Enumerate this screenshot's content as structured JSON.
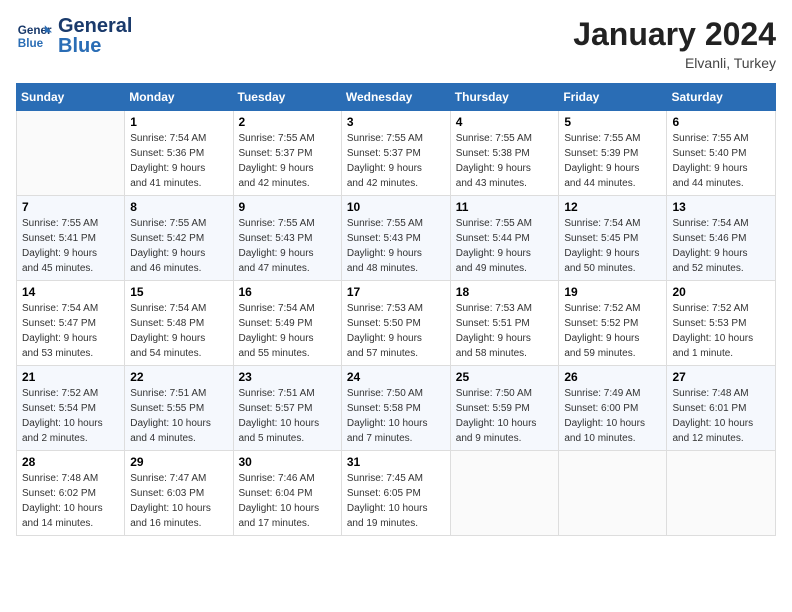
{
  "header": {
    "logo_text_general": "General",
    "logo_text_blue": "Blue",
    "month_title": "January 2024",
    "location": "Elvanli, Turkey"
  },
  "weekdays": [
    "Sunday",
    "Monday",
    "Tuesday",
    "Wednesday",
    "Thursday",
    "Friday",
    "Saturday"
  ],
  "weeks": [
    [
      {
        "day": "",
        "content": ""
      },
      {
        "day": "1",
        "content": "Sunrise: 7:54 AM\nSunset: 5:36 PM\nDaylight: 9 hours\nand 41 minutes."
      },
      {
        "day": "2",
        "content": "Sunrise: 7:55 AM\nSunset: 5:37 PM\nDaylight: 9 hours\nand 42 minutes."
      },
      {
        "day": "3",
        "content": "Sunrise: 7:55 AM\nSunset: 5:37 PM\nDaylight: 9 hours\nand 42 minutes."
      },
      {
        "day": "4",
        "content": "Sunrise: 7:55 AM\nSunset: 5:38 PM\nDaylight: 9 hours\nand 43 minutes."
      },
      {
        "day": "5",
        "content": "Sunrise: 7:55 AM\nSunset: 5:39 PM\nDaylight: 9 hours\nand 44 minutes."
      },
      {
        "day": "6",
        "content": "Sunrise: 7:55 AM\nSunset: 5:40 PM\nDaylight: 9 hours\nand 44 minutes."
      }
    ],
    [
      {
        "day": "7",
        "content": "Sunrise: 7:55 AM\nSunset: 5:41 PM\nDaylight: 9 hours\nand 45 minutes."
      },
      {
        "day": "8",
        "content": "Sunrise: 7:55 AM\nSunset: 5:42 PM\nDaylight: 9 hours\nand 46 minutes."
      },
      {
        "day": "9",
        "content": "Sunrise: 7:55 AM\nSunset: 5:43 PM\nDaylight: 9 hours\nand 47 minutes."
      },
      {
        "day": "10",
        "content": "Sunrise: 7:55 AM\nSunset: 5:43 PM\nDaylight: 9 hours\nand 48 minutes."
      },
      {
        "day": "11",
        "content": "Sunrise: 7:55 AM\nSunset: 5:44 PM\nDaylight: 9 hours\nand 49 minutes."
      },
      {
        "day": "12",
        "content": "Sunrise: 7:54 AM\nSunset: 5:45 PM\nDaylight: 9 hours\nand 50 minutes."
      },
      {
        "day": "13",
        "content": "Sunrise: 7:54 AM\nSunset: 5:46 PM\nDaylight: 9 hours\nand 52 minutes."
      }
    ],
    [
      {
        "day": "14",
        "content": "Sunrise: 7:54 AM\nSunset: 5:47 PM\nDaylight: 9 hours\nand 53 minutes."
      },
      {
        "day": "15",
        "content": "Sunrise: 7:54 AM\nSunset: 5:48 PM\nDaylight: 9 hours\nand 54 minutes."
      },
      {
        "day": "16",
        "content": "Sunrise: 7:54 AM\nSunset: 5:49 PM\nDaylight: 9 hours\nand 55 minutes."
      },
      {
        "day": "17",
        "content": "Sunrise: 7:53 AM\nSunset: 5:50 PM\nDaylight: 9 hours\nand 57 minutes."
      },
      {
        "day": "18",
        "content": "Sunrise: 7:53 AM\nSunset: 5:51 PM\nDaylight: 9 hours\nand 58 minutes."
      },
      {
        "day": "19",
        "content": "Sunrise: 7:52 AM\nSunset: 5:52 PM\nDaylight: 9 hours\nand 59 minutes."
      },
      {
        "day": "20",
        "content": "Sunrise: 7:52 AM\nSunset: 5:53 PM\nDaylight: 10 hours\nand 1 minute."
      }
    ],
    [
      {
        "day": "21",
        "content": "Sunrise: 7:52 AM\nSunset: 5:54 PM\nDaylight: 10 hours\nand 2 minutes."
      },
      {
        "day": "22",
        "content": "Sunrise: 7:51 AM\nSunset: 5:55 PM\nDaylight: 10 hours\nand 4 minutes."
      },
      {
        "day": "23",
        "content": "Sunrise: 7:51 AM\nSunset: 5:57 PM\nDaylight: 10 hours\nand 5 minutes."
      },
      {
        "day": "24",
        "content": "Sunrise: 7:50 AM\nSunset: 5:58 PM\nDaylight: 10 hours\nand 7 minutes."
      },
      {
        "day": "25",
        "content": "Sunrise: 7:50 AM\nSunset: 5:59 PM\nDaylight: 10 hours\nand 9 minutes."
      },
      {
        "day": "26",
        "content": "Sunrise: 7:49 AM\nSunset: 6:00 PM\nDaylight: 10 hours\nand 10 minutes."
      },
      {
        "day": "27",
        "content": "Sunrise: 7:48 AM\nSunset: 6:01 PM\nDaylight: 10 hours\nand 12 minutes."
      }
    ],
    [
      {
        "day": "28",
        "content": "Sunrise: 7:48 AM\nSunset: 6:02 PM\nDaylight: 10 hours\nand 14 minutes."
      },
      {
        "day": "29",
        "content": "Sunrise: 7:47 AM\nSunset: 6:03 PM\nDaylight: 10 hours\nand 16 minutes."
      },
      {
        "day": "30",
        "content": "Sunrise: 7:46 AM\nSunset: 6:04 PM\nDaylight: 10 hours\nand 17 minutes."
      },
      {
        "day": "31",
        "content": "Sunrise: 7:45 AM\nSunset: 6:05 PM\nDaylight: 10 hours\nand 19 minutes."
      },
      {
        "day": "",
        "content": ""
      },
      {
        "day": "",
        "content": ""
      },
      {
        "day": "",
        "content": ""
      }
    ]
  ]
}
